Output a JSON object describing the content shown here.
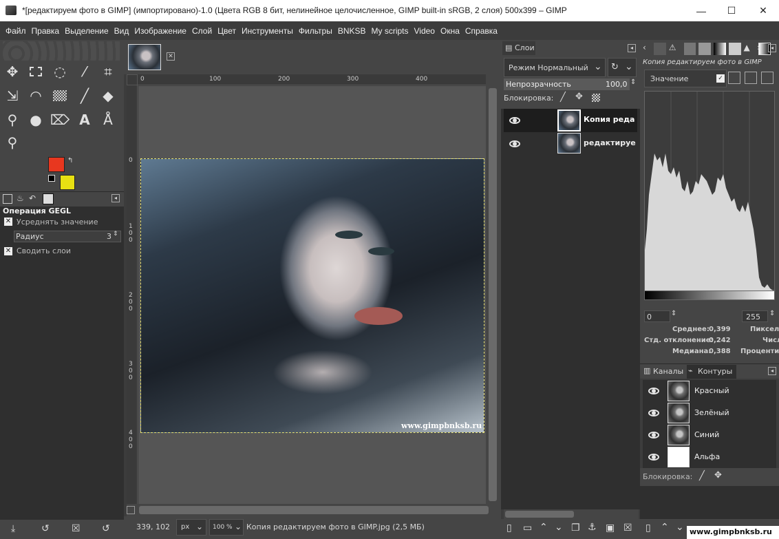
{
  "window": {
    "title": "*[редактируем фото в GIMP] (импортировано)-1.0 (Цвета RGB 8 бит, нелинейное целочисленное, GIMP built-in sRGB, 2 слоя) 500x399 – GIMP",
    "minimize": "—",
    "maximize": "☐",
    "close": "✕"
  },
  "menu": [
    "Файл",
    "Правка",
    "Выделение",
    "Вид",
    "Изображение",
    "Слой",
    "Цвет",
    "Инструменты",
    "Фильтры",
    "BNKSB",
    "My scripts",
    "Video",
    "Окна",
    "Справка"
  ],
  "toolbox": {
    "tools": [
      "move-icon",
      "rect-select-icon",
      "lasso-icon",
      "fuzzy-select-icon",
      "crop-icon",
      "transform-icon",
      "warp-icon",
      "gradient-icon",
      "paintbrush-icon",
      "eraser-icon",
      "clone-icon",
      "smudge-icon",
      "dodge-icon",
      "text-icon",
      "path-icon",
      "zoom-icon"
    ],
    "fg_color": "#e8371f",
    "bg_color": "#e8e012"
  },
  "tool_options": {
    "header": "Операция GEGL",
    "average_label": "Усреднять значение",
    "radius_label": "Радиус",
    "radius_value": "3",
    "merge_label": "Сводить слои"
  },
  "canvas": {
    "ruler_top_labels": [
      "0",
      "100",
      "200",
      "300",
      "400"
    ],
    "ruler_left_labels": [
      "0",
      "1\n0\n0",
      "2\n0\n0",
      "3\n0\n0",
      "4\n0\n0"
    ],
    "watermark": "www.gimpbnksb.ru"
  },
  "layers": {
    "tab_label": "Слои",
    "mode_label": "Режим Нормальный",
    "opacity_label": "Непрозрачность",
    "opacity_value": "100,0",
    "lock_label": "Блокировка:",
    "items": [
      {
        "name": "Копия реда"
      },
      {
        "name": "редактируе"
      }
    ]
  },
  "histogram": {
    "title": "Копия редактируем фото в GIMP",
    "channel_label": "Значение",
    "range_min": "0",
    "range_max": "255",
    "stats": [
      {
        "label": "Среднее:",
        "value": "0,399",
        "right": "Пиксел"
      },
      {
        "label": "Стд. отклонение:",
        "value": "0,242",
        "right": "Числ"
      },
      {
        "label": "Медиана:",
        "value": "0,388",
        "right": "Процентил"
      }
    ]
  },
  "channels": {
    "tab_channels": "Каналы",
    "tab_paths": "Контуры",
    "items": [
      {
        "name": "Красный"
      },
      {
        "name": "Зелёный"
      },
      {
        "name": "Синий"
      },
      {
        "name": "Альфа"
      }
    ],
    "lock_label": "Блокировка:"
  },
  "statusbar": {
    "coords": "339, 102",
    "unit": "px",
    "zoom": "100 %",
    "file_info": "Копия редактируем фото в GIMP.jpg (2,5 МБ)",
    "watermark": "www.gimpbnksb.ru"
  }
}
